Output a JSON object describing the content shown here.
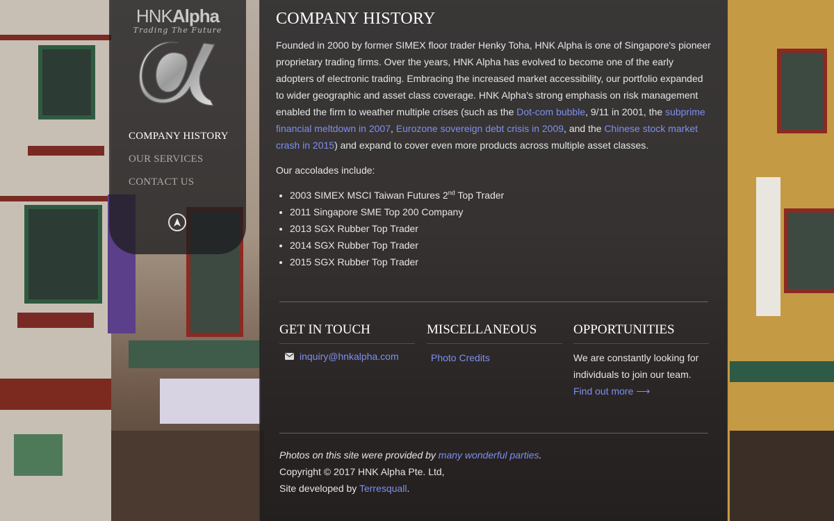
{
  "sidebar": {
    "logo_text_light": "HNK",
    "logo_text_bold": "Alpha",
    "logo_tagline": "Trading The Future",
    "logo_icon": "alpha-icon",
    "nav": [
      {
        "label": "Company History",
        "active": true
      },
      {
        "label": "Our Services",
        "active": false
      },
      {
        "label": "Contact Us",
        "active": false
      }
    ],
    "scroll_top_icon": "navigation-arrow-icon"
  },
  "main": {
    "title": "Company History",
    "intro": {
      "t1": "Founded in 2000 by former SIMEX floor trader Henky Toha, HNK Alpha is one of Singapore's pioneer proprietary trading firms. Over the years, HNK Alpha has evolved to become one of the early adopters of electronic trading. Embracing the increased market accessibility, our portfolio expanded to wider geographic and asset class coverage. HNK Alpha's strong emphasis on risk management enabled the firm to weather multiple crises (such as the ",
      "link1": "Dot-com bubble",
      "t2": ", 9/11 in 2001, the ",
      "link2": "subprime financial meltdown in 2007",
      "t3": ", ",
      "link3": "Eurozone sovereign debt crisis in 2009",
      "t4": ", and the ",
      "link4": "Chinese stock market crash in 2015",
      "t5": ") and expand to cover even more products across multiple asset classes."
    },
    "accolades_intro": "Our accolades include:",
    "accolades": [
      {
        "pre": "2003 SIMEX MSCI Taiwan Futures 2",
        "sup": "nd",
        "post": " Top Trader"
      },
      {
        "pre": "2011 Singapore SME Top 200 Company",
        "sup": "",
        "post": ""
      },
      {
        "pre": "2013 SGX Rubber Top Trader",
        "sup": "",
        "post": ""
      },
      {
        "pre": "2014 SGX Rubber Top Trader",
        "sup": "",
        "post": ""
      },
      {
        "pre": "2015 SGX Rubber Top Trader",
        "sup": "",
        "post": ""
      }
    ]
  },
  "footer": {
    "contact": {
      "heading": "Get in Touch",
      "email": "inquiry@hnkalpha.com",
      "icon": "envelope-icon"
    },
    "misc": {
      "heading": "Miscellaneous",
      "link": "Photo Credits"
    },
    "opps": {
      "heading": "Opportunities",
      "text": "We are constantly looking for individuals to join our team. ",
      "link": "Find out more ⟶"
    },
    "credits": {
      "photos_pre": "Photos on this site were provided by ",
      "photos_link": "many wonderful parties",
      "photos_post": ".",
      "copyright": "Copyright © 2017 HNK Alpha Pte. Ltd,",
      "dev_pre": "Site developed by ",
      "dev_link": "Terresquall",
      "dev_post": "."
    }
  },
  "colors": {
    "link": "#7f8ff0",
    "panel": "#19191b",
    "text": "#e6e6e6"
  }
}
